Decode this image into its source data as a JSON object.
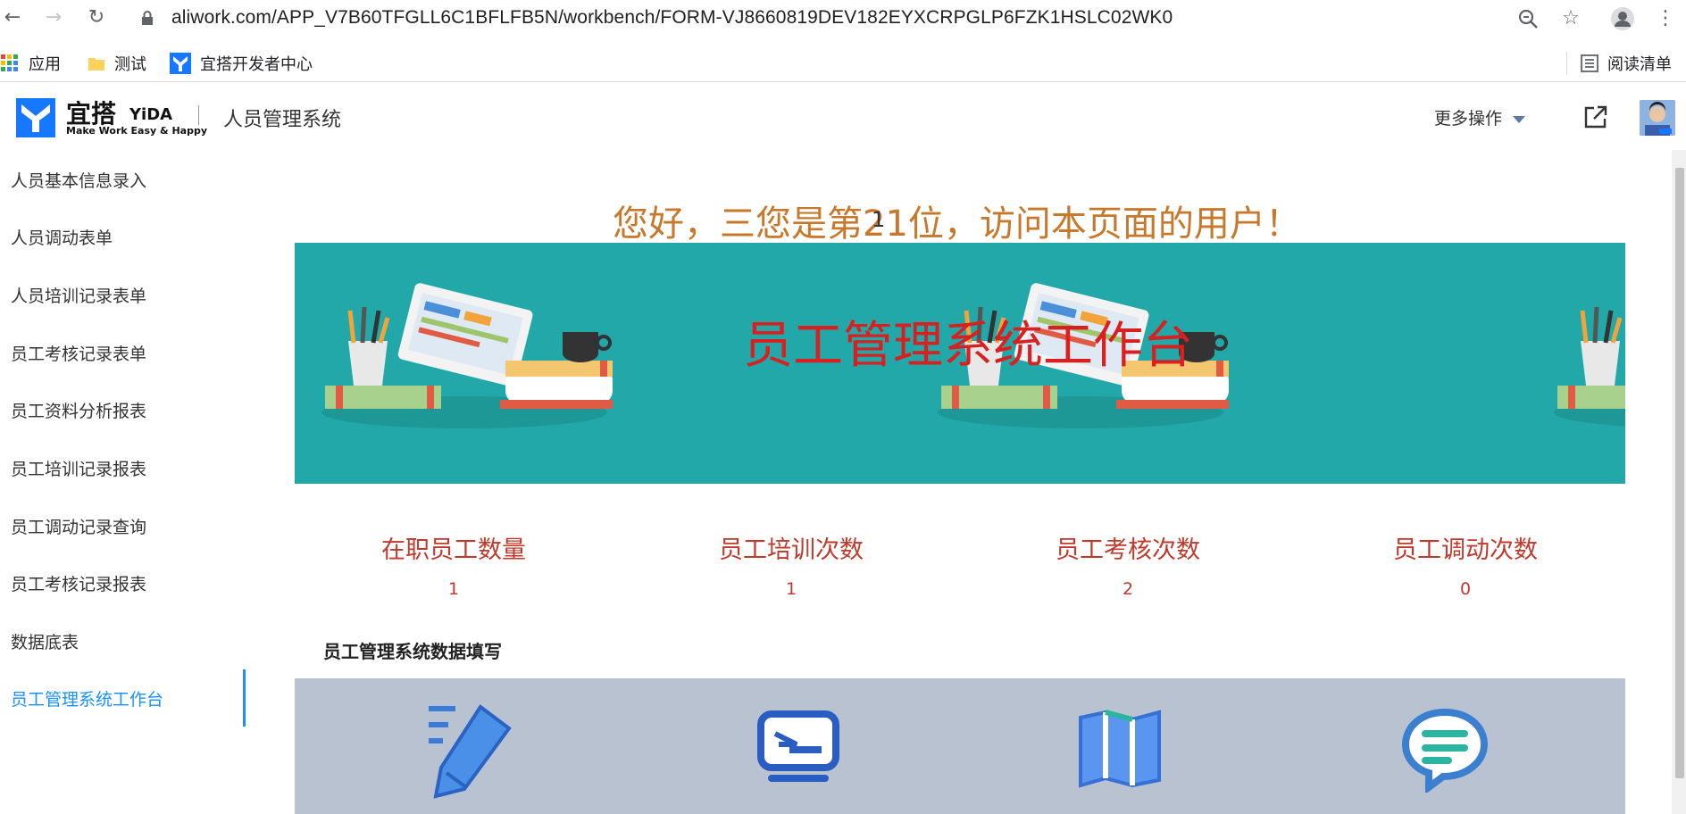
{
  "browser": {
    "url": "aliwork.com/APP_V7B60TFGLL6C1BFLFB5N/workbench/FORM-VJ8660819DEV182EYXCRPGLP6FZK1HSLC02WK0",
    "bookmarks": [
      "应用",
      "测试",
      "宜搭开发者中心"
    ],
    "reading_list": "阅读清单"
  },
  "header": {
    "brand_cn": "宜搭",
    "brand_en": "YiDA",
    "brand_slogan": "Make Work Easy & Happy",
    "app_title": "人员管理系统",
    "more_ops": "更多操作"
  },
  "sidebar": {
    "items": [
      {
        "label": "人员基本信息录入"
      },
      {
        "label": "人员调动表单"
      },
      {
        "label": "人员培训记录表单"
      },
      {
        "label": "员工考核记录表单"
      },
      {
        "label": "员工资料分析报表"
      },
      {
        "label": "员工培训记录报表"
      },
      {
        "label": "员工调动记录查询"
      },
      {
        "label": "员工考核记录报表"
      },
      {
        "label": "数据底表"
      },
      {
        "label": "员工管理系统工作台"
      }
    ],
    "active_index": 9
  },
  "main": {
    "greeting": "您好，三您是第21位，访问本页面的用户！",
    "greeting_overlay": "1",
    "banner_title": "员工管理系统工作台",
    "stats": [
      {
        "label": "在职员工数量",
        "value": "1"
      },
      {
        "label": "员工培训次数",
        "value": "1"
      },
      {
        "label": "员工考核次数",
        "value": "2"
      },
      {
        "label": "员工调动次数",
        "value": "0"
      }
    ],
    "section_title": "员工管理系统数据填写",
    "panel_icons": [
      "pencil-icon",
      "laptop-icon",
      "map-icon",
      "chat-icon"
    ]
  },
  "colors": {
    "accent": "#1890ff",
    "banner_bg": "#22a8a8",
    "greeting": "#c8782a",
    "stat_text": "#c0392b"
  }
}
